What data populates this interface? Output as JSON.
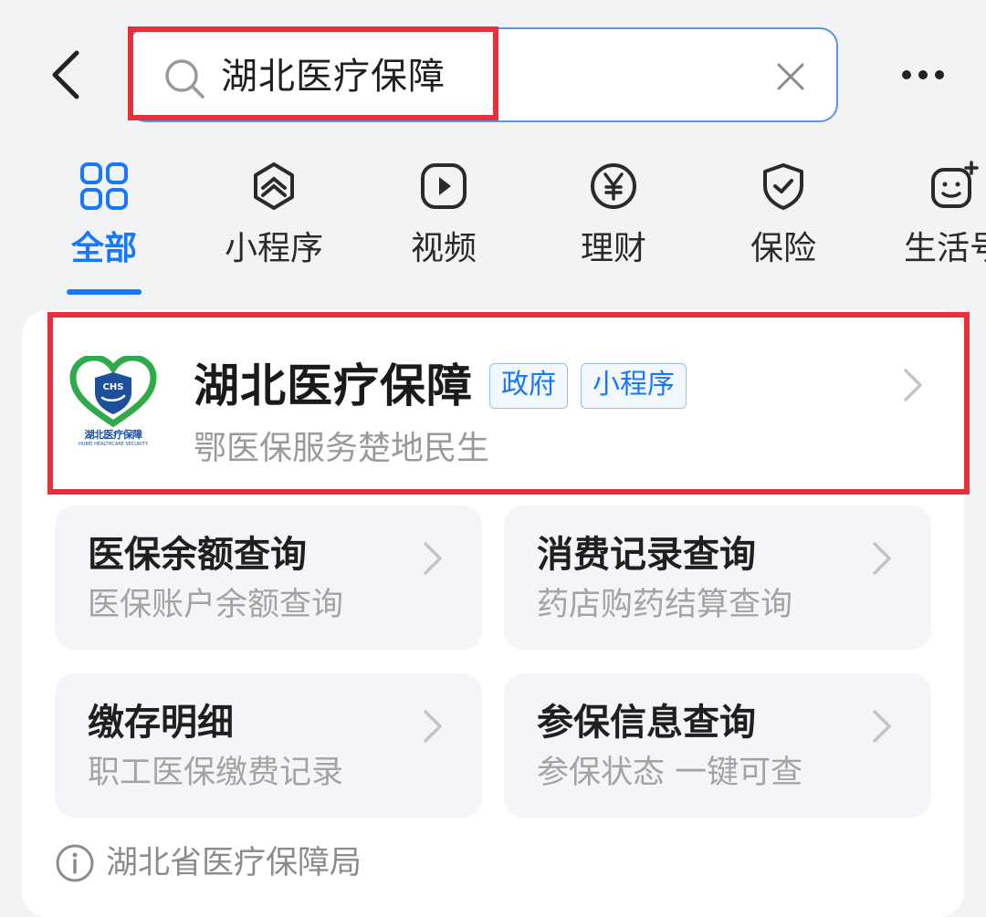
{
  "search": {
    "query": "湖北医疗保障"
  },
  "tabs": [
    {
      "label": "全部",
      "icon": "grid-icon",
      "active": true
    },
    {
      "label": "小程序",
      "icon": "mini-program-icon",
      "active": false
    },
    {
      "label": "视频",
      "icon": "play-icon",
      "active": false
    },
    {
      "label": "理财",
      "icon": "yen-icon",
      "active": false
    },
    {
      "label": "保险",
      "icon": "shield-check-icon",
      "active": false
    },
    {
      "label": "生活号",
      "icon": "life-account-icon",
      "active": false
    }
  ],
  "result": {
    "title": "湖北医疗保障",
    "badges": [
      "政府",
      "小程序"
    ],
    "description": "鄂医保服务楚地民生",
    "logo": {
      "caption": "湖北医疗保障",
      "subcaption": "HUBEI HEALTHCARE SECURITY",
      "mark": "CHS"
    }
  },
  "services": [
    {
      "title": "医保余额查询",
      "subtitle": "医保账户余额查询"
    },
    {
      "title": "消费记录查询",
      "subtitle": "药店购药结算查询"
    },
    {
      "title": "缴存明细",
      "subtitle": "职工医保缴费记录"
    },
    {
      "title": "参保信息查询",
      "subtitle": "参保状态 一键可查"
    }
  ],
  "provider": {
    "name": "湖北省医疗保障局"
  },
  "colors": {
    "accent": "#1677ff",
    "highlight_border": "#e8303a",
    "search_border": "#5b93e6",
    "logo_green": "#2eaa4a",
    "logo_blue": "#1d4f9c"
  }
}
